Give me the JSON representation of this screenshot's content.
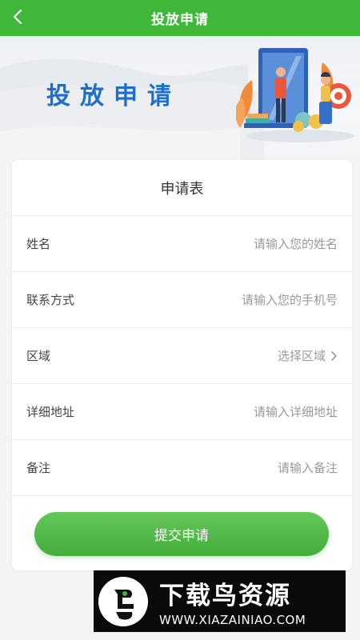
{
  "header": {
    "title": "投放申请"
  },
  "banner": {
    "title": "投放申请"
  },
  "form": {
    "title": "申请表",
    "fields": [
      {
        "label": "姓名",
        "placeholder": "请输入您的姓名",
        "value": ""
      },
      {
        "label": "联系方式",
        "placeholder": "请输入您的手机号",
        "value": ""
      },
      {
        "label": "区域",
        "placeholder": "选择区域",
        "value": ""
      },
      {
        "label": "详细地址",
        "placeholder": "请输入详细地址",
        "value": ""
      },
      {
        "label": "备注",
        "placeholder": "请输入备注",
        "value": ""
      }
    ],
    "submit_label": "提交申请"
  },
  "watermark": {
    "name": "下载鸟资源",
    "url": "WWW.XIAZAINIAO.COM"
  },
  "colors": {
    "primary_green": "#3fb83a",
    "banner_title_blue": "#1f6fc9"
  },
  "icons": {
    "back": "back-arrow-icon",
    "region_chevron": "chevron-right-icon"
  }
}
